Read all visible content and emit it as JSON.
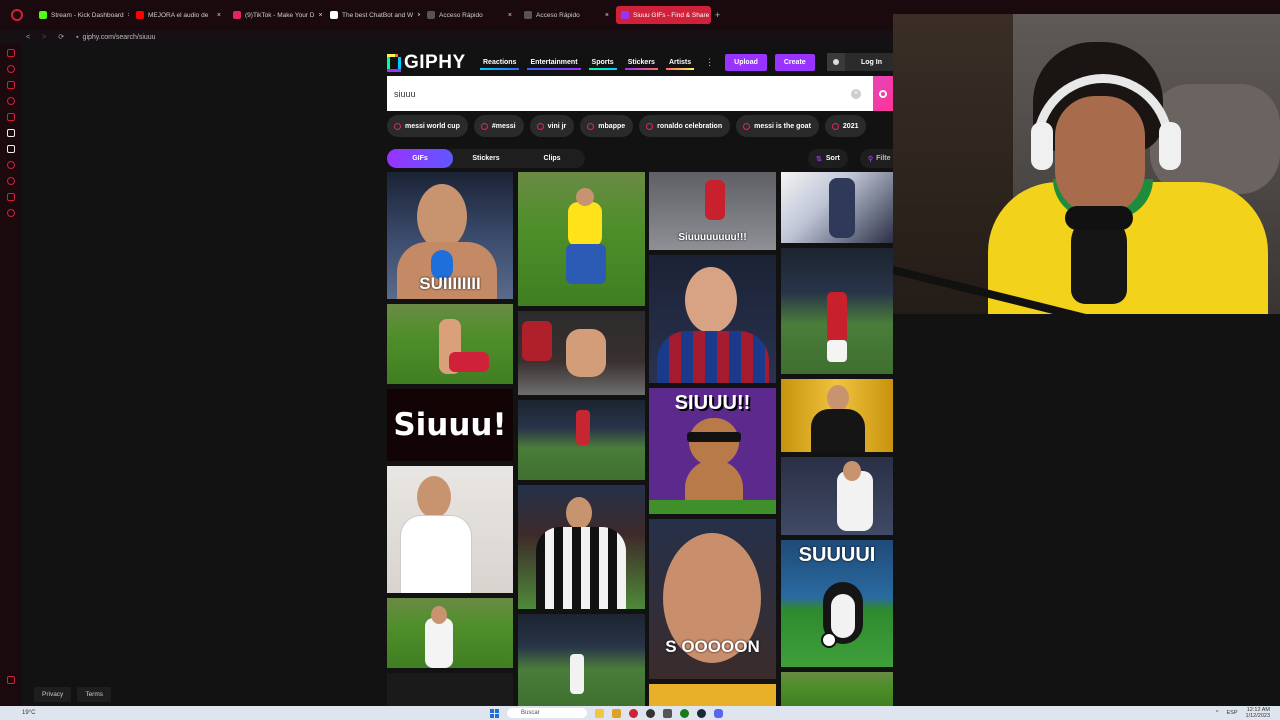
{
  "browser": {
    "tabs": [
      {
        "title": "Stream - Kick Dashboard",
        "color": "#53fc18"
      },
      {
        "title": "MEJORA el audio de",
        "color": "#ff0000"
      },
      {
        "title": "(9)TikTok - Make Your D",
        "color": "#111111"
      },
      {
        "title": "The best ChatBot and W",
        "color": "#ffffff"
      },
      {
        "title": "Acceso Rápido",
        "color": "#555555"
      },
      {
        "title": "Acceso Rápido",
        "color": "#555555"
      },
      {
        "title": "Siuuu GIFs - Find & Share",
        "color": "#9933ff"
      }
    ],
    "new_tab": "+",
    "url": "giphy.com/search/siuuu"
  },
  "giphy": {
    "logo": "GIPHY",
    "nav": [
      "Reactions",
      "Entertainment",
      "Sports",
      "Stickers",
      "Artists"
    ],
    "more": "⋮",
    "upload": "Upload",
    "create": "Create",
    "login": "Log In",
    "search_value": "siuuu",
    "suggestions": [
      "messi world cup",
      "#messi",
      "vini jr",
      "mbappe",
      "ronaldo celebration",
      "messi is the goat",
      "2021"
    ],
    "filters": [
      "GIFs",
      "Stickers",
      "Clips"
    ],
    "sort": "Sort",
    "filter": "Filte",
    "gifs": {
      "g1": "SUIIIIIIII",
      "g7": "Siuuuuuuuu!!!",
      "g10": "Siuuu!",
      "g13": "SIUUU!!",
      "g18": "SUUUUI",
      "g19": "S OOOOON"
    },
    "footer": [
      "Privacy",
      "Terms"
    ]
  },
  "taskbar": {
    "weather": "19°C",
    "search_placeholder": "Buscar",
    "lang": "ESP",
    "time": "12:12 AM",
    "date": "1/12/2023"
  },
  "colors": {
    "accent": "#d0213b",
    "giphy_purple": "#9933ff",
    "giphy_pink": "#ff3399"
  }
}
